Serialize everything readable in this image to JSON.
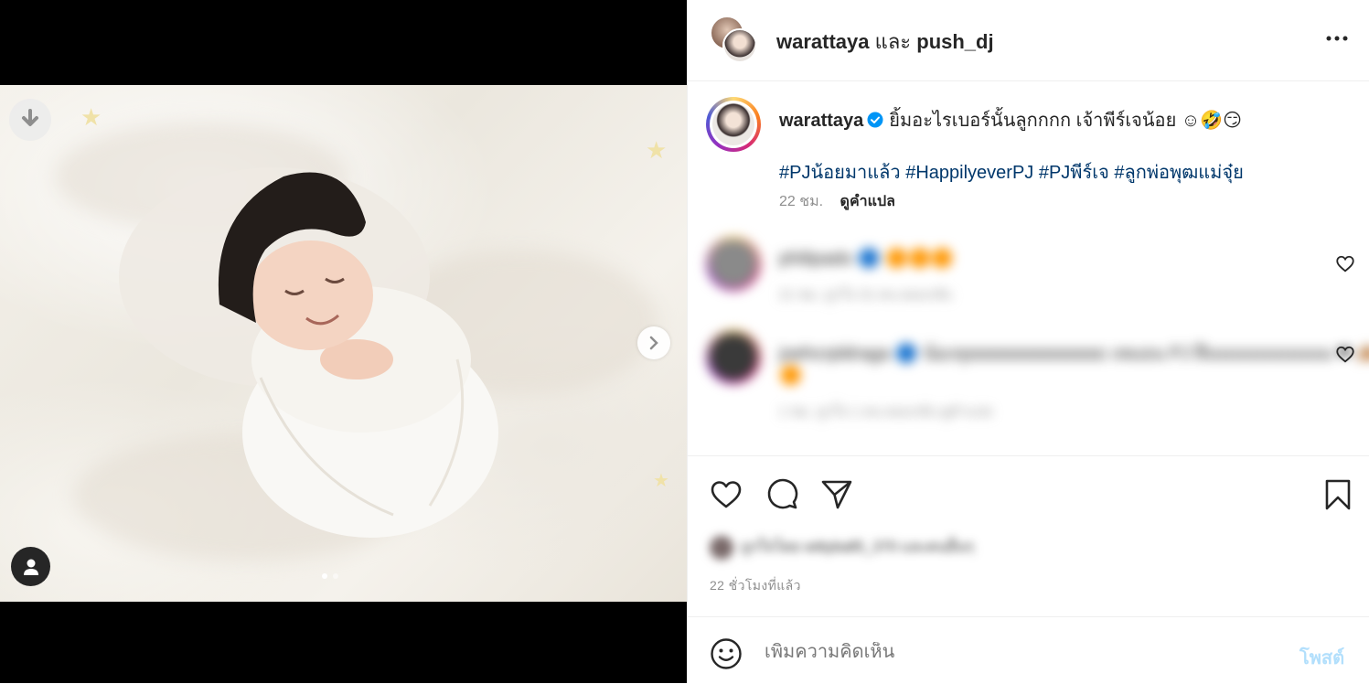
{
  "post_header": {
    "user1": "warattaya",
    "and_text": "และ",
    "user2": "push_dj"
  },
  "caption": {
    "username": "warattaya",
    "text": "ยิ้มอะไรเบอร์นั้นลูกกกก เจ้าพีร์เจน้อย ☺🤣😏",
    "hashtags": "#PJน้อยมาแล้ว #HappilyeverPJ #PJพีร์เจ #ลูกพ่อพุฒแม่จุ๋ย",
    "time_ago": "22 ชม.",
    "translate_label": "ดูคำแปล"
  },
  "comments": [
    {
      "text": "philipado 🔵 🟠🟠🟠",
      "meta": "21 ชม.    ถูกใจ 31 คน    ตอบกลับ"
    },
    {
      "text": "joehcrpldraga 🔵 น้องจุยยยยยยยยยยยยย เหมอน PJ ฝืนนนนนนนนนน ❤ 🙈",
      "text2": "🟠",
      "meta": "1 ชม.    ถูกใจ 1 คน    ตอบกลับ    ดูคำแปล"
    }
  ],
  "likes_text": "ถูกใจโดย wittyball5_370 และคนอื่นๆ",
  "timestamp": "22 ชั่วโมงที่แล้ว",
  "composer": {
    "placeholder": "เพิ่มความคิดเห็น",
    "post_label": "โพสต์"
  },
  "icons": {
    "download": "download-icon",
    "next": "chevron-right-icon",
    "tagged_user": "user-icon",
    "more": "more-horizontal-icon",
    "like": "heart-icon",
    "comment": "comment-icon",
    "share": "send-icon",
    "save": "bookmark-icon",
    "emoji": "emoji-icon",
    "verified": "verified-badge-icon"
  },
  "colors": {
    "hashtag": "#00376b",
    "verified": "#0095f6",
    "post_disabled": "#b2dffc"
  }
}
